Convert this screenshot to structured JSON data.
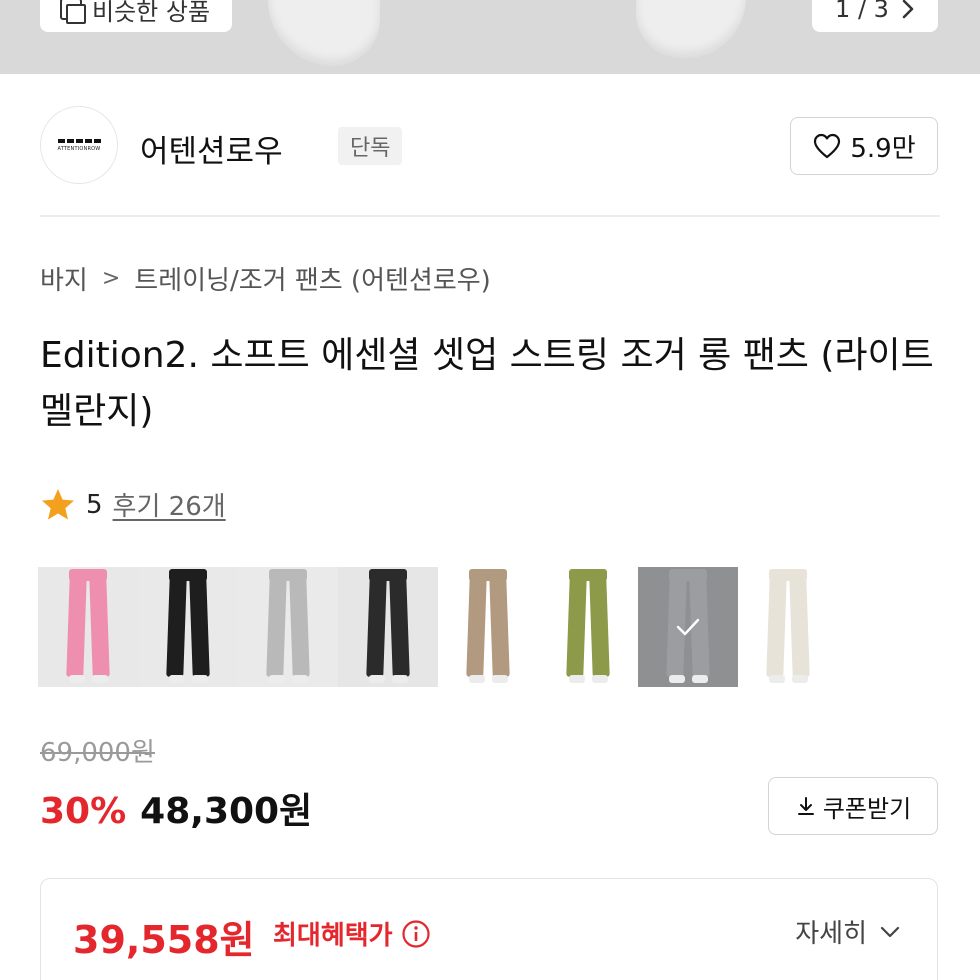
{
  "hero": {
    "similar_label": "비슷한 상품",
    "pager": "1 / 3",
    "pager_icon": "chevron-right-icon"
  },
  "brand": {
    "name": "어텐션로우",
    "logo_text": "ATTENTIONROW",
    "badge": "단독",
    "like_count": "5.9만",
    "like_icon": "heart-outline-icon"
  },
  "breadcrumb": [
    "바지",
    "트레이닝/조거 팬츠 (어텐션로우)"
  ],
  "product": {
    "title": "Edition2. 소프트 에센셜 셋업 스트링 조거 롱 팬츠 (라이트멜란지)"
  },
  "rating": {
    "score": "5",
    "reviews": "후기 26개",
    "star_color": "#f2a01d"
  },
  "color_options": [
    {
      "name": "multi",
      "bg": "#e8e8e8",
      "pants": "#ef8fb0",
      "selected": false
    },
    {
      "name": "black",
      "bg": "#e9e9e9",
      "pants": "#1e1e1e",
      "selected": false
    },
    {
      "name": "melange gray",
      "bg": "#eaeaea",
      "pants": "#b9b9b9",
      "selected": false
    },
    {
      "name": "charcoal",
      "bg": "#e6e6e6",
      "pants": "#2b2b2b",
      "selected": false
    },
    {
      "name": "beige",
      "bg": "#ffffff",
      "pants": "#b19a7f",
      "selected": false
    },
    {
      "name": "khaki",
      "bg": "#ffffff",
      "pants": "#8c9a4a",
      "selected": false
    },
    {
      "name": "light melange",
      "bg": "#8f9091",
      "pants": "#9b9da1",
      "selected": true
    },
    {
      "name": "ivory",
      "bg": "#ffffff",
      "pants": "#e8e3d8",
      "selected": false
    }
  ],
  "price": {
    "original": "69,000원",
    "discount": "30%",
    "sale": "48,300원",
    "coupon_label": "쿠폰받기",
    "coupon_icon": "download-icon"
  },
  "benefit": {
    "price": "39,558원",
    "label": "최대혜택가",
    "info_icon": "info-icon",
    "detail_label": "자세히",
    "detail_icon": "chevron-down-icon"
  },
  "colors": {
    "accent_red": "#e4262d",
    "border": "#d4d4d4"
  }
}
